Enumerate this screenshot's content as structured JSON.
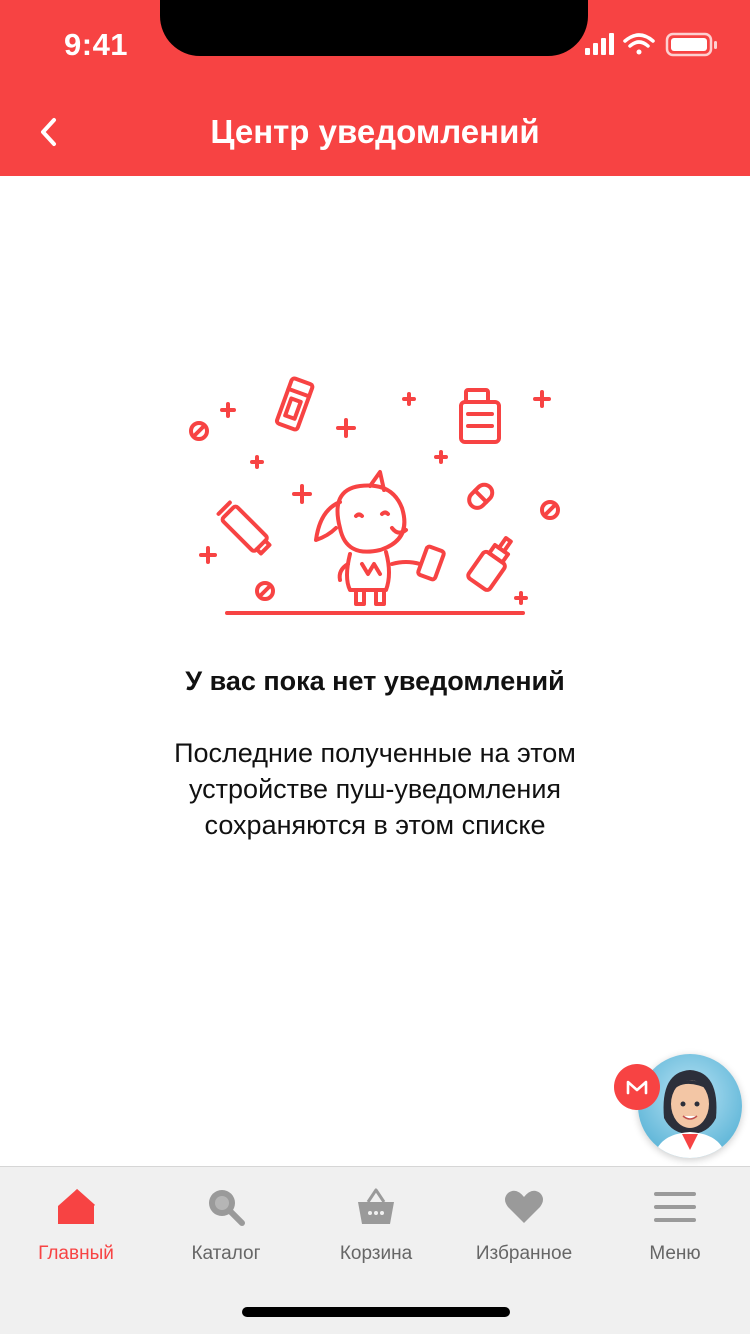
{
  "status_bar": {
    "time": "9:41"
  },
  "nav": {
    "title": "Центр уведомлений"
  },
  "empty_state": {
    "title": "У вас пока нет уведомлений",
    "description": "Последние полученные на этом устройстве пуш-уведомления сохраняются в этом списке"
  },
  "tabbar": {
    "items": [
      {
        "label": "Главный",
        "icon": "home-icon",
        "active": true
      },
      {
        "label": "Каталог",
        "icon": "search-icon",
        "active": false
      },
      {
        "label": "Корзина",
        "icon": "basket-icon",
        "active": false
      },
      {
        "label": "Избранное",
        "icon": "heart-icon",
        "active": false
      },
      {
        "label": "Меню",
        "icon": "menu-icon",
        "active": false
      }
    ]
  },
  "colors": {
    "brand": "#f74343",
    "tab_inactive": "#666666",
    "tab_icon_inactive": "#9a9a9a",
    "tabbar_bg": "#f0f0f0"
  }
}
